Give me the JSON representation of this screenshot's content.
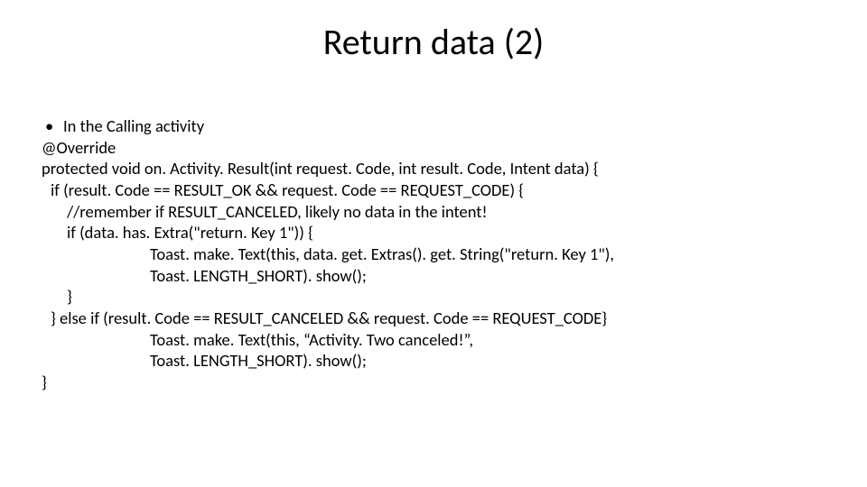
{
  "slide": {
    "title": "Return data (2)",
    "bullet": "In the Calling activity",
    "code": {
      "l1": "@Override",
      "l2": "protected void on. Activity. Result(int request. Code, int result. Code, Intent data) {",
      "l3": "if (result. Code == RESULT_OK && request. Code == REQUEST_CODE) {",
      "l4": "//remember if RESULT_CANCELED, likely no data in the intent!",
      "l5": "if (data. has. Extra(\"return. Key 1\")) {",
      "l6": "Toast. make. Text(this, data. get. Extras(). get. String(\"return. Key 1\"),",
      "l7": "Toast. LENGTH_SHORT). show();",
      "l8": "}",
      "l9": "} else if (result. Code == RESULT_CANCELED && request. Code == REQUEST_CODE}",
      "l10": "Toast. make. Text(this, “Activity. Two canceled!”,",
      "l11": "Toast. LENGTH_SHORT). show();",
      "l12": "}"
    }
  }
}
